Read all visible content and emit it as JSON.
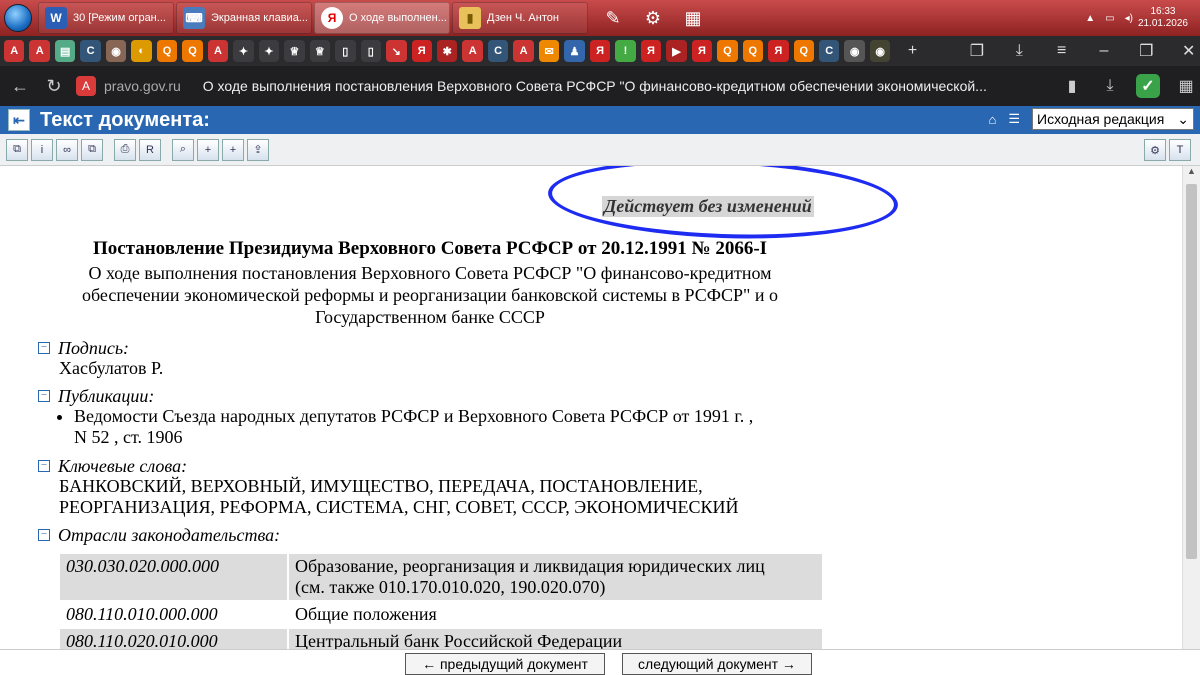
{
  "taskbar": {
    "windows": [
      {
        "icon": "W",
        "label": "30 [Режим огран...",
        "active": false
      },
      {
        "icon": "⌨",
        "label": "Экранная клавиа...",
        "active": false
      },
      {
        "icon": "Я",
        "label": "О ходе выполнен...",
        "active": true
      },
      {
        "icon": "📁",
        "label": "Дзен Ч. Антон",
        "active": false
      }
    ],
    "time": "16:33",
    "date": "21.01.2026"
  },
  "browser": {
    "domain": "pravo.gov.ru",
    "tab_title": "О ходе выполнения постановления Верховного Совета РСФСР \"О финансово-кредитном обеспечении экономической..."
  },
  "page_header": {
    "title": "Текст документа:",
    "edition_selected": "Исходная редакция"
  },
  "document": {
    "status": "Действует без изменений",
    "title": "Постановление Президиума Верховного Совета РСФСР от 20.12.1991 № 2066-I",
    "subtitle_line1": "О ходе выполнения постановления Верховного Совета РСФСР \"О финансово-кредитном",
    "subtitle_line2": "обеспечении экономической реформы и реорганизации банковской системы в РСФСР\" и о",
    "subtitle_line3": "Государственном банке СССР",
    "signature_label": "Подпись:",
    "signature_value": "Хасбулатов Р.",
    "publications_label": "Публикации:",
    "publication_line1": "Ведомости Съезда народных депутатов РСФСР и Верховного Совета РСФСР от 1991 г. ,",
    "publication_line2": "N 52 , ст. 1906",
    "keywords_label": "Ключевые слова:",
    "keywords_line1": "БАНКОВСКИЙ, ВЕРХОВНЫЙ, ИМУЩЕСТВО, ПЕРЕДАЧА, ПОСТАНОВЛЕНИЕ,",
    "keywords_line2": "РЕОРГАНИЗАЦИЯ, РЕФОРМА, СИСТЕМА, СНГ, СОВЕТ, СССР, ЭКОНОМИЧЕСКИЙ",
    "branches_label": "Отрасли законодательства:",
    "branches": [
      {
        "code": "030.030.020.000.000",
        "desc_line1": "Образование, реорганизация и ликвидация юридических лиц",
        "desc_line2": "(см. также 010.170.010.020, 190.020.070)"
      },
      {
        "code": "080.110.010.000.000",
        "desc_line1": "Общие положения",
        "desc_line2": ""
      },
      {
        "code": "080.110.020.010.000",
        "desc_line1": "Центральный банк Российской Федерации",
        "desc_line2": ""
      }
    ]
  },
  "bottom_nav": {
    "prev_label": "← предыдущий документ",
    "next_label": "следующий документ →"
  }
}
